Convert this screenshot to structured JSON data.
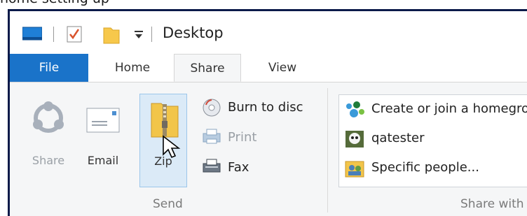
{
  "caption": {
    "text": "home setting up"
  },
  "window": {
    "title": "Desktop",
    "quick_access": [
      "properties-icon",
      "new-folder-icon",
      "customize-dropdown-icon"
    ]
  },
  "tabs": [
    {
      "label": "File"
    },
    {
      "label": "Home"
    },
    {
      "label": "Share"
    },
    {
      "label": "View"
    }
  ],
  "ribbon": {
    "send": {
      "share_label": "Share",
      "email_label": "Email",
      "zip_label": "Zip",
      "burn_label": "Burn to disc",
      "print_label": "Print",
      "fax_label": "Fax",
      "group_label": "Send"
    },
    "share_with": {
      "items": [
        {
          "label": "Create or join a homegroup",
          "icon": "homegroup-icon"
        },
        {
          "label": "qatester",
          "icon": "user-icon"
        },
        {
          "label": "Specific people...",
          "icon": "people-icon"
        }
      ],
      "group_label": "Share with"
    }
  },
  "colors": {
    "file_tab": "#1a73c9",
    "ribbon_bg": "#f5f6f7",
    "zip_highlight": "#dbeaf7",
    "window_border": "#0b1a4a"
  }
}
